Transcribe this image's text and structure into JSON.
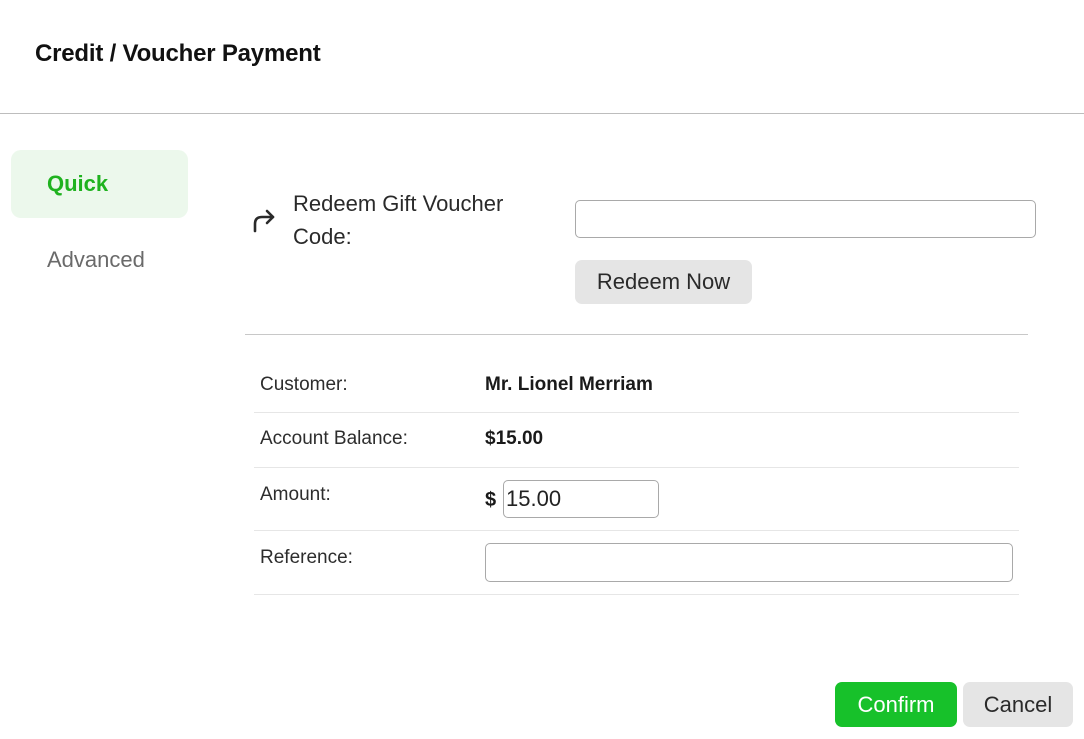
{
  "dialog": {
    "title": "Credit / Voucher Payment"
  },
  "tabs": [
    {
      "label": "Quick",
      "active": true
    },
    {
      "label": "Advanced",
      "active": false
    }
  ],
  "redeem": {
    "icon": "redo-arrow-icon",
    "label": "Redeem Gift Voucher Code:",
    "input_value": "",
    "button_label": "Redeem Now"
  },
  "details": {
    "customer_label": "Customer:",
    "customer_value": "Mr. Lionel Merriam",
    "balance_label": "Account Balance:",
    "balance_value": "$15.00",
    "amount_label": "Amount:",
    "amount_currency": "$",
    "amount_value": "15.00",
    "reference_label": "Reference:",
    "reference_value": ""
  },
  "footer": {
    "confirm_label": "Confirm",
    "cancel_label": "Cancel"
  },
  "colors": {
    "accent": "#17c12a",
    "active_tab_bg": "#ecf8ec",
    "active_tab_text": "#1fb21f",
    "secondary_button_bg": "#e5e5e5"
  }
}
